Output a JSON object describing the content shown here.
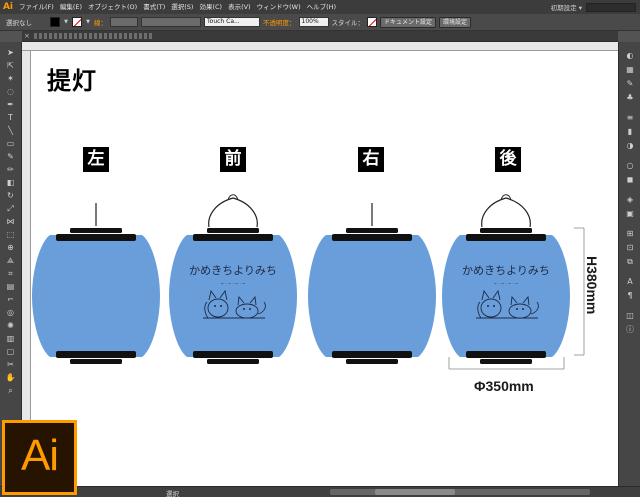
{
  "app": {
    "logo_small": "Ai",
    "logo_large": "Ai"
  },
  "menubar": {
    "items": [
      "ファイル(F)",
      "編集(E)",
      "オブジェクト(O)",
      "書式(T)",
      "選択(S)",
      "効果(C)",
      "表示(V)",
      "ウィンドウ(W)",
      "ヘルプ(H)"
    ],
    "workspace": "初期設定 ▾"
  },
  "controlbar": {
    "selection": "選択なし",
    "stroke_label": "線：",
    "brush": "Touch Ca...",
    "opacity_label": "不透明度：",
    "opacity": "100%",
    "style_label": "スタイル：",
    "doc_settings": "ドキュメント設定",
    "prefs": "環境設定"
  },
  "status": {
    "tool": "選択"
  },
  "artboard": {
    "title": "提灯",
    "views": [
      "左",
      "前",
      "右",
      "後"
    ],
    "logo_text": "かめきちよりみち",
    "dimensions": {
      "height": "H380mm",
      "width": "Φ350mm"
    }
  },
  "colors": {
    "lantern_body": "#6a9edb",
    "lantern_cap": "#111111",
    "accent": "#ff9a00",
    "wire": "#222222"
  },
  "icons": [
    "selection-tool-icon",
    "direct-selection-tool-icon",
    "magic-wand-icon",
    "lasso-icon",
    "pen-icon",
    "type-icon",
    "line-icon",
    "rectangle-icon",
    "paintbrush-icon",
    "pencil-icon",
    "eraser-icon",
    "rotate-icon",
    "scale-icon",
    "width-icon",
    "free-transform-icon",
    "shape-builder-icon",
    "perspective-icon",
    "mesh-icon",
    "gradient-icon",
    "eyedropper-icon",
    "blend-icon",
    "symbol-sprayer-icon",
    "graph-icon",
    "artboard-icon",
    "slice-icon",
    "hand-icon",
    "zoom-icon",
    "color-panel-icon",
    "swatches-icon",
    "brushes-icon",
    "symbols-icon",
    "stroke-panel-icon",
    "gradient-panel-icon",
    "transparency-icon",
    "appearance-icon",
    "graphic-styles-icon",
    "layers-icon",
    "artboards-panel-icon",
    "align-icon",
    "transform-icon",
    "pathfinder-icon"
  ]
}
